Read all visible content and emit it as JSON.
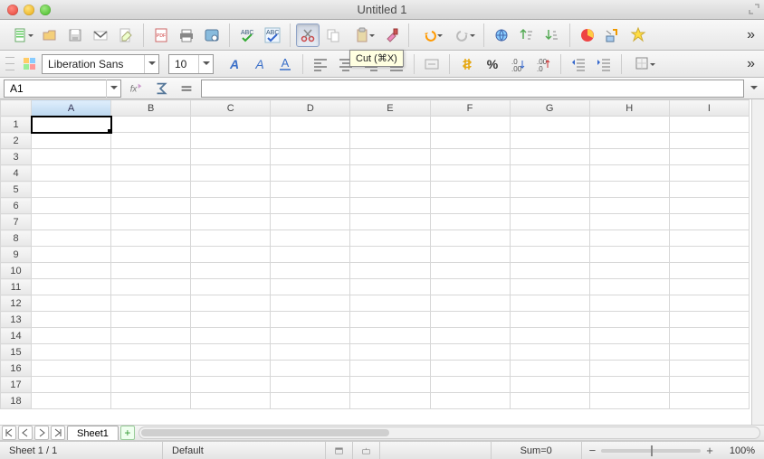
{
  "window": {
    "title": "Untitled 1"
  },
  "tooltip": {
    "text": "Cut (⌘X)"
  },
  "toolbar_row1": {
    "overflow": "»"
  },
  "toolbar_row2": {
    "font_name": "Liberation Sans",
    "font_size": "10",
    "percent_label": "%",
    "indent_placeholder": "",
    "overflow": "»"
  },
  "formula_bar": {
    "cell_ref": "A1",
    "formula": ""
  },
  "grid": {
    "columns": [
      "A",
      "B",
      "C",
      "D",
      "E",
      "F",
      "G",
      "H",
      "I"
    ],
    "rows": [
      "1",
      "2",
      "3",
      "4",
      "5",
      "6",
      "7",
      "8",
      "9",
      "10",
      "11",
      "12",
      "13",
      "14",
      "15",
      "16",
      "17",
      "18"
    ],
    "selected": {
      "col": "A",
      "row": "1"
    }
  },
  "tabs": {
    "sheet_name": "Sheet1"
  },
  "status": {
    "sheet_count": "Sheet 1 / 1",
    "style": "Default",
    "sum": "Sum=0",
    "zoom": "100%"
  }
}
